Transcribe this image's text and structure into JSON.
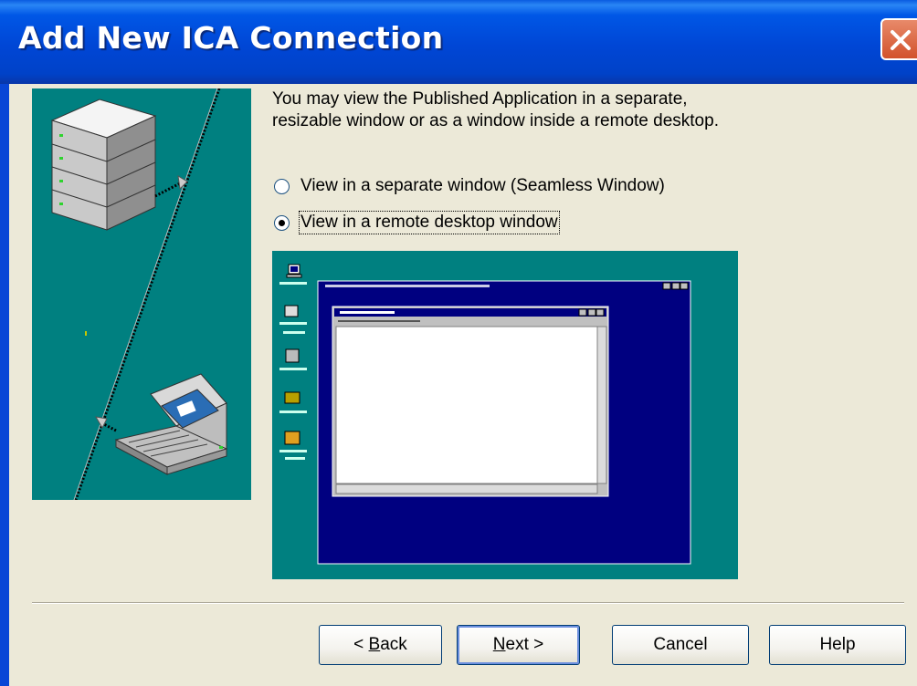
{
  "window": {
    "title": "Add New ICA Connection"
  },
  "description": {
    "line1": "You may view the Published Application in a separate,",
    "line2": "resizable window or as a window inside a remote desktop."
  },
  "options": {
    "seamless": {
      "label": "View in a separate window (Seamless Window)",
      "checked": false
    },
    "remote_desktop": {
      "label": "View in a remote desktop window",
      "checked": true
    }
  },
  "buttons": {
    "back": {
      "prefix": "< ",
      "mnemonic": "B",
      "rest": "ack"
    },
    "next": {
      "mnemonic": "N",
      "rest": "ext >"
    },
    "cancel": "Cancel",
    "help": "Help"
  },
  "colors": {
    "titlebar": "#0046d5",
    "dialog_bg": "#ece9d8",
    "teal": "#008080",
    "desktop_blue": "#000080"
  }
}
